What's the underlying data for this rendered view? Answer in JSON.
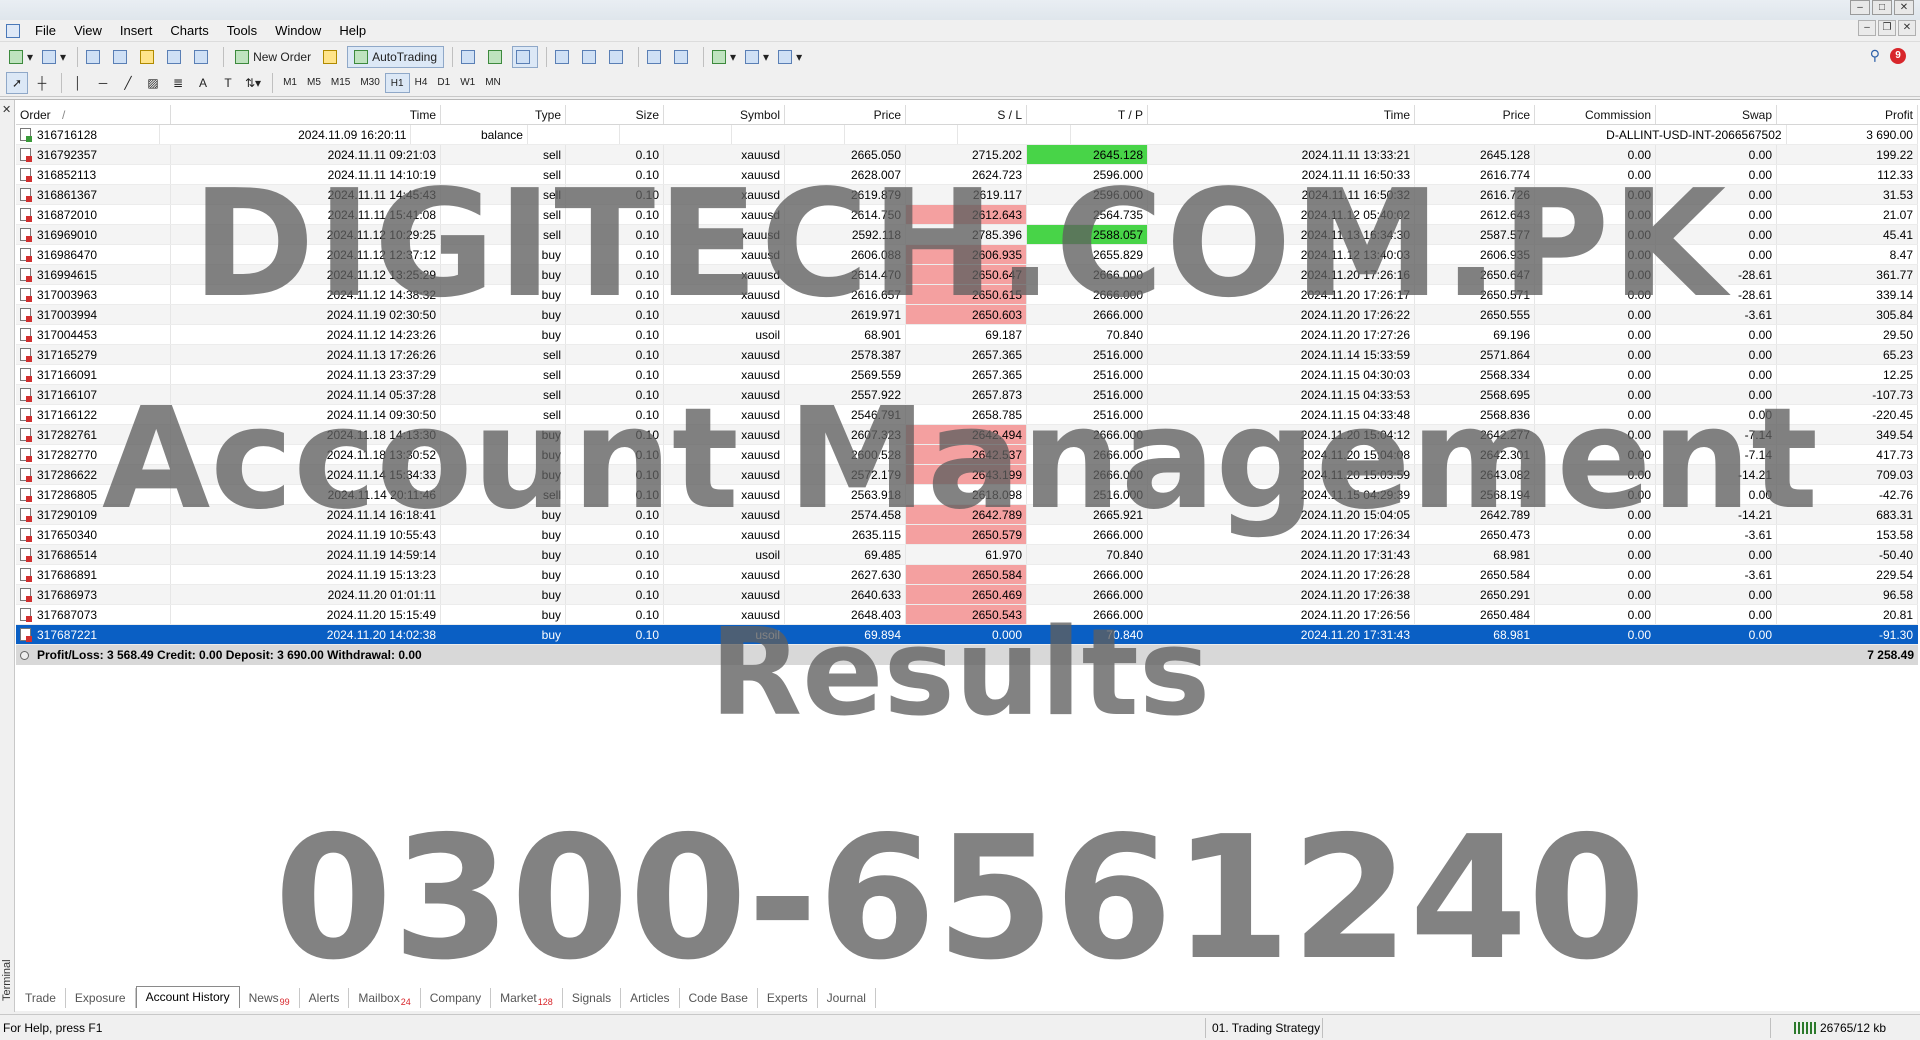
{
  "menu": [
    "File",
    "View",
    "Insert",
    "Charts",
    "Tools",
    "Window",
    "Help"
  ],
  "toolbar": {
    "new_order": "New Order",
    "autotrading": "AutoTrading",
    "timeframes": [
      "M1",
      "M5",
      "M15",
      "M30",
      "H1",
      "H4",
      "D1",
      "W1",
      "MN"
    ],
    "notification_count": "9"
  },
  "side_label": "Terminal",
  "columns": [
    "Order",
    "Time",
    "Type",
    "Size",
    "Symbol",
    "Price",
    "S / L",
    "T / P",
    "Time",
    "Price",
    "Commission",
    "Swap",
    "Profit"
  ],
  "sort_indicator": "/",
  "balance_row": {
    "order": "316716128",
    "time": "2024.11.09 16:20:11",
    "type": "balance",
    "comment": "D-ALLINT-USD-INT-2066567502",
    "profit": "3 690.00"
  },
  "rows": [
    {
      "order": "316792357",
      "time": "2024.11.11 09:21:03",
      "type": "sell",
      "size": "0.10",
      "symbol": "xauusd",
      "price": "2665.050",
      "sl": "2715.202",
      "tp": "2645.128",
      "ctime": "2024.11.11 13:33:21",
      "cprice": "2645.128",
      "comm": "0.00",
      "swap": "0.00",
      "profit": "199.22",
      "hl_sl": "",
      "hl_tp": "green"
    },
    {
      "order": "316852113",
      "time": "2024.11.11 14:10:19",
      "type": "sell",
      "size": "0.10",
      "symbol": "xauusd",
      "price": "2628.007",
      "sl": "2624.723",
      "tp": "2596.000",
      "ctime": "2024.11.11 16:50:33",
      "cprice": "2616.774",
      "comm": "0.00",
      "swap": "0.00",
      "profit": "112.33",
      "hl_sl": "",
      "hl_tp": ""
    },
    {
      "order": "316861367",
      "time": "2024.11.11 14:45:43",
      "type": "sell",
      "size": "0.10",
      "symbol": "xauusd",
      "price": "2619.879",
      "sl": "2619.117",
      "tp": "2596.000",
      "ctime": "2024.11.11 16:50:32",
      "cprice": "2616.726",
      "comm": "0.00",
      "swap": "0.00",
      "profit": "31.53",
      "hl_sl": "",
      "hl_tp": ""
    },
    {
      "order": "316872010",
      "time": "2024.11.11 15:41:08",
      "type": "sell",
      "size": "0.10",
      "symbol": "xauusd",
      "price": "2614.750",
      "sl": "2612.643",
      "tp": "2564.735",
      "ctime": "2024.11.12 05:40:02",
      "cprice": "2612.643",
      "comm": "0.00",
      "swap": "0.00",
      "profit": "21.07",
      "hl_sl": "red",
      "hl_tp": ""
    },
    {
      "order": "316969010",
      "time": "2024.11.12 10:29:25",
      "type": "sell",
      "size": "0.10",
      "symbol": "xauusd",
      "price": "2592.118",
      "sl": "2785.396",
      "tp": "2588.057",
      "ctime": "2024.11.13 16:34:30",
      "cprice": "2587.577",
      "comm": "0.00",
      "swap": "0.00",
      "profit": "45.41",
      "hl_sl": "",
      "hl_tp": "green"
    },
    {
      "order": "316986470",
      "time": "2024.11.12 12:37:12",
      "type": "buy",
      "size": "0.10",
      "symbol": "xauusd",
      "price": "2606.088",
      "sl": "2606.935",
      "tp": "2655.829",
      "ctime": "2024.11.12 13:40:03",
      "cprice": "2606.935",
      "comm": "0.00",
      "swap": "0.00",
      "profit": "8.47",
      "hl_sl": "red",
      "hl_tp": ""
    },
    {
      "order": "316994615",
      "time": "2024.11.12 13:25:29",
      "type": "buy",
      "size": "0.10",
      "symbol": "xauusd",
      "price": "2614.470",
      "sl": "2650.647",
      "tp": "2666.000",
      "ctime": "2024.11.20 17:26:16",
      "cprice": "2650.647",
      "comm": "0.00",
      "swap": "-28.61",
      "profit": "361.77",
      "hl_sl": "red",
      "hl_tp": ""
    },
    {
      "order": "317003963",
      "time": "2024.11.12 14:38:32",
      "type": "buy",
      "size": "0.10",
      "symbol": "xauusd",
      "price": "2616.657",
      "sl": "2650.615",
      "tp": "2666.000",
      "ctime": "2024.11.20 17:26:17",
      "cprice": "2650.571",
      "comm": "0.00",
      "swap": "-28.61",
      "profit": "339.14",
      "hl_sl": "red",
      "hl_tp": ""
    },
    {
      "order": "317003994",
      "time": "2024.11.19 02:30:50",
      "type": "buy",
      "size": "0.10",
      "symbol": "xauusd",
      "price": "2619.971",
      "sl": "2650.603",
      "tp": "2666.000",
      "ctime": "2024.11.20 17:26:22",
      "cprice": "2650.555",
      "comm": "0.00",
      "swap": "-3.61",
      "profit": "305.84",
      "hl_sl": "red",
      "hl_tp": ""
    },
    {
      "order": "317004453",
      "time": "2024.11.12 14:23:26",
      "type": "buy",
      "size": "0.10",
      "symbol": "usoil",
      "price": "68.901",
      "sl": "69.187",
      "tp": "70.840",
      "ctime": "2024.11.20 17:27:26",
      "cprice": "69.196",
      "comm": "0.00",
      "swap": "0.00",
      "profit": "29.50",
      "hl_sl": "",
      "hl_tp": ""
    },
    {
      "order": "317165279",
      "time": "2024.11.13 17:26:26",
      "type": "sell",
      "size": "0.10",
      "symbol": "xauusd",
      "price": "2578.387",
      "sl": "2657.365",
      "tp": "2516.000",
      "ctime": "2024.11.14 15:33:59",
      "cprice": "2571.864",
      "comm": "0.00",
      "swap": "0.00",
      "profit": "65.23",
      "hl_sl": "",
      "hl_tp": ""
    },
    {
      "order": "317166091",
      "time": "2024.11.13 23:37:29",
      "type": "sell",
      "size": "0.10",
      "symbol": "xauusd",
      "price": "2569.559",
      "sl": "2657.365",
      "tp": "2516.000",
      "ctime": "2024.11.15 04:30:03",
      "cprice": "2568.334",
      "comm": "0.00",
      "swap": "0.00",
      "profit": "12.25",
      "hl_sl": "",
      "hl_tp": ""
    },
    {
      "order": "317166107",
      "time": "2024.11.14 05:37:28",
      "type": "sell",
      "size": "0.10",
      "symbol": "xauusd",
      "price": "2557.922",
      "sl": "2657.873",
      "tp": "2516.000",
      "ctime": "2024.11.15 04:33:53",
      "cprice": "2568.695",
      "comm": "0.00",
      "swap": "0.00",
      "profit": "-107.73",
      "hl_sl": "",
      "hl_tp": ""
    },
    {
      "order": "317166122",
      "time": "2024.11.14 09:30:50",
      "type": "sell",
      "size": "0.10",
      "symbol": "xauusd",
      "price": "2546.791",
      "sl": "2658.785",
      "tp": "2516.000",
      "ctime": "2024.11.15 04:33:48",
      "cprice": "2568.836",
      "comm": "0.00",
      "swap": "0.00",
      "profit": "-220.45",
      "hl_sl": "",
      "hl_tp": ""
    },
    {
      "order": "317282761",
      "time": "2024.11.18 14:13:30",
      "type": "buy",
      "size": "0.10",
      "symbol": "xauusd",
      "price": "2607.323",
      "sl": "2642.494",
      "tp": "2666.000",
      "ctime": "2024.11.20 15:04:12",
      "cprice": "2642.277",
      "comm": "0.00",
      "swap": "-7.14",
      "profit": "349.54",
      "hl_sl": "red",
      "hl_tp": ""
    },
    {
      "order": "317282770",
      "time": "2024.11.18 13:30:52",
      "type": "buy",
      "size": "0.10",
      "symbol": "xauusd",
      "price": "2600.528",
      "sl": "2642.537",
      "tp": "2666.000",
      "ctime": "2024.11.20 15:04:08",
      "cprice": "2642.301",
      "comm": "0.00",
      "swap": "-7.14",
      "profit": "417.73",
      "hl_sl": "red",
      "hl_tp": ""
    },
    {
      "order": "317286622",
      "time": "2024.11.14 15:34:33",
      "type": "buy",
      "size": "0.10",
      "symbol": "xauusd",
      "price": "2572.179",
      "sl": "2643.199",
      "tp": "2666.000",
      "ctime": "2024.11.20 15:03:59",
      "cprice": "2643.082",
      "comm": "0.00",
      "swap": "-14.21",
      "profit": "709.03",
      "hl_sl": "red",
      "hl_tp": ""
    },
    {
      "order": "317286805",
      "time": "2024.11.14 20:11:46",
      "type": "sell",
      "size": "0.10",
      "symbol": "xauusd",
      "price": "2563.918",
      "sl": "2618.098",
      "tp": "2516.000",
      "ctime": "2024.11.15 04:29:39",
      "cprice": "2568.194",
      "comm": "0.00",
      "swap": "0.00",
      "profit": "-42.76",
      "hl_sl": "",
      "hl_tp": ""
    },
    {
      "order": "317290109",
      "time": "2024.11.14 16:18:41",
      "type": "buy",
      "size": "0.10",
      "symbol": "xauusd",
      "price": "2574.458",
      "sl": "2642.789",
      "tp": "2665.921",
      "ctime": "2024.11.20 15:04:05",
      "cprice": "2642.789",
      "comm": "0.00",
      "swap": "-14.21",
      "profit": "683.31",
      "hl_sl": "red",
      "hl_tp": ""
    },
    {
      "order": "317650340",
      "time": "2024.11.19 10:55:43",
      "type": "buy",
      "size": "0.10",
      "symbol": "xauusd",
      "price": "2635.115",
      "sl": "2650.579",
      "tp": "2666.000",
      "ctime": "2024.11.20 17:26:34",
      "cprice": "2650.473",
      "comm": "0.00",
      "swap": "-3.61",
      "profit": "153.58",
      "hl_sl": "red",
      "hl_tp": ""
    },
    {
      "order": "317686514",
      "time": "2024.11.19 14:59:14",
      "type": "buy",
      "size": "0.10",
      "symbol": "usoil",
      "price": "69.485",
      "sl": "61.970",
      "tp": "70.840",
      "ctime": "2024.11.20 17:31:43",
      "cprice": "68.981",
      "comm": "0.00",
      "swap": "0.00",
      "profit": "-50.40",
      "hl_sl": "",
      "hl_tp": ""
    },
    {
      "order": "317686891",
      "time": "2024.11.19 15:13:23",
      "type": "buy",
      "size": "0.10",
      "symbol": "xauusd",
      "price": "2627.630",
      "sl": "2650.584",
      "tp": "2666.000",
      "ctime": "2024.11.20 17:26:28",
      "cprice": "2650.584",
      "comm": "0.00",
      "swap": "-3.61",
      "profit": "229.54",
      "hl_sl": "red",
      "hl_tp": ""
    },
    {
      "order": "317686973",
      "time": "2024.11.20 01:01:11",
      "type": "buy",
      "size": "0.10",
      "symbol": "xauusd",
      "price": "2640.633",
      "sl": "2650.469",
      "tp": "2666.000",
      "ctime": "2024.11.20 17:26:38",
      "cprice": "2650.291",
      "comm": "0.00",
      "swap": "0.00",
      "profit": "96.58",
      "hl_sl": "red",
      "hl_tp": ""
    },
    {
      "order": "317687073",
      "time": "2024.11.20 15:15:49",
      "type": "buy",
      "size": "0.10",
      "symbol": "xauusd",
      "price": "2648.403",
      "sl": "2650.543",
      "tp": "2666.000",
      "ctime": "2024.11.20 17:26:56",
      "cprice": "2650.484",
      "comm": "0.00",
      "swap": "0.00",
      "profit": "20.81",
      "hl_sl": "red",
      "hl_tp": ""
    },
    {
      "order": "317687221",
      "time": "2024.11.20 14:02:38",
      "type": "buy",
      "size": "0.10",
      "symbol": "usoil",
      "price": "69.894",
      "sl": "0.000",
      "tp": "70.840",
      "ctime": "2024.11.20 17:31:43",
      "cprice": "68.981",
      "comm": "0.00",
      "swap": "0.00",
      "profit": "-91.30",
      "hl_sl": "",
      "hl_tp": "",
      "selected": true
    }
  ],
  "summary": {
    "text": "Profit/Loss: 3 568.49  Credit: 0.00  Deposit: 3 690.00  Withdrawal: 0.00",
    "total": "7 258.49"
  },
  "watermark": {
    "line1": "DIGITECH.COM.PK",
    "line2": "Account Management",
    "line3": "Results",
    "line4": "0300-6561240"
  },
  "tabs": [
    {
      "label": "Trade",
      "badge": ""
    },
    {
      "label": "Exposure",
      "badge": ""
    },
    {
      "label": "Account History",
      "badge": "",
      "active": true
    },
    {
      "label": "News",
      "badge": "99"
    },
    {
      "label": "Alerts",
      "badge": ""
    },
    {
      "label": "Mailbox",
      "badge": "24"
    },
    {
      "label": "Company",
      "badge": ""
    },
    {
      "label": "Market",
      "badge": "128"
    },
    {
      "label": "Signals",
      "badge": ""
    },
    {
      "label": "Articles",
      "badge": ""
    },
    {
      "label": "Code Base",
      "badge": ""
    },
    {
      "label": "Experts",
      "badge": ""
    },
    {
      "label": "Journal",
      "badge": ""
    }
  ],
  "status": {
    "help": "For Help, press F1",
    "strategy": "01. Trading Strategy",
    "traffic": "26765/12 kb"
  },
  "colors": {
    "selection": "#0a5fc4",
    "sl_highlight": "#f4a0a0",
    "tp_highlight": "#48d448",
    "badge_red": "#d8262b"
  }
}
